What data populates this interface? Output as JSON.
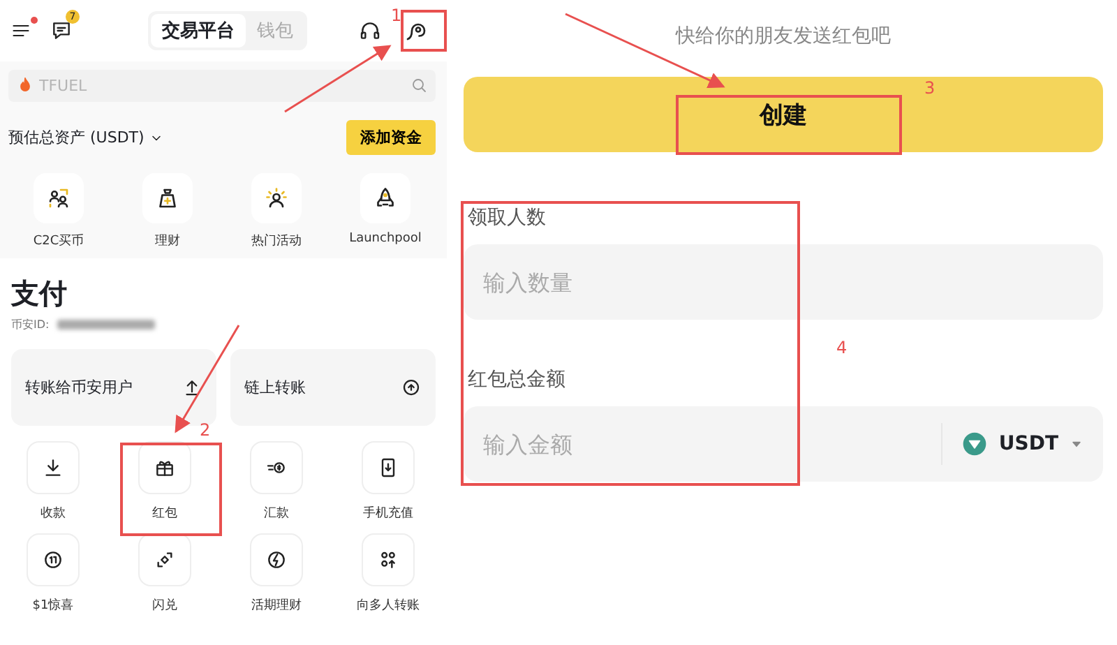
{
  "left_screen": {
    "header": {
      "notification_count": "7",
      "menu_dot": true,
      "tabs": [
        {
          "label": "交易平台",
          "selected": true
        },
        {
          "label": "钱包",
          "selected": false
        }
      ]
    },
    "search": {
      "placeholder": "TFUEL"
    },
    "assets": {
      "label": "预估总资产 (USDT)",
      "button": "添加资金"
    },
    "shortcuts": [
      {
        "label": "C2C买币"
      },
      {
        "label": "理财"
      },
      {
        "label": "热门活动"
      },
      {
        "label": "Launchpool"
      }
    ],
    "pay": {
      "title": "支付",
      "id_label": "币安ID:",
      "cards": [
        {
          "label": "转账给币安用户"
        },
        {
          "label": "链上转账"
        }
      ],
      "actions": [
        {
          "label": "收款"
        },
        {
          "label": "红包"
        },
        {
          "label": "汇款"
        },
        {
          "label": "手机充值"
        },
        {
          "label": "$1惊喜"
        },
        {
          "label": "闪兑"
        },
        {
          "label": "活期理财"
        },
        {
          "label": "向多人转账"
        }
      ]
    }
  },
  "right_screen": {
    "subtitle": "快给你的朋友发送红包吧",
    "create_button": "创建",
    "fields": [
      {
        "label": "领取人数",
        "placeholder": "输入数量",
        "kind": "plain"
      },
      {
        "label": "红包总金额",
        "placeholder": "输入金额",
        "kind": "currency",
        "currency": "USDT"
      }
    ]
  },
  "annotations": [
    {
      "label": "1"
    },
    {
      "label": "2"
    },
    {
      "label": "3"
    },
    {
      "label": "4"
    }
  ]
}
